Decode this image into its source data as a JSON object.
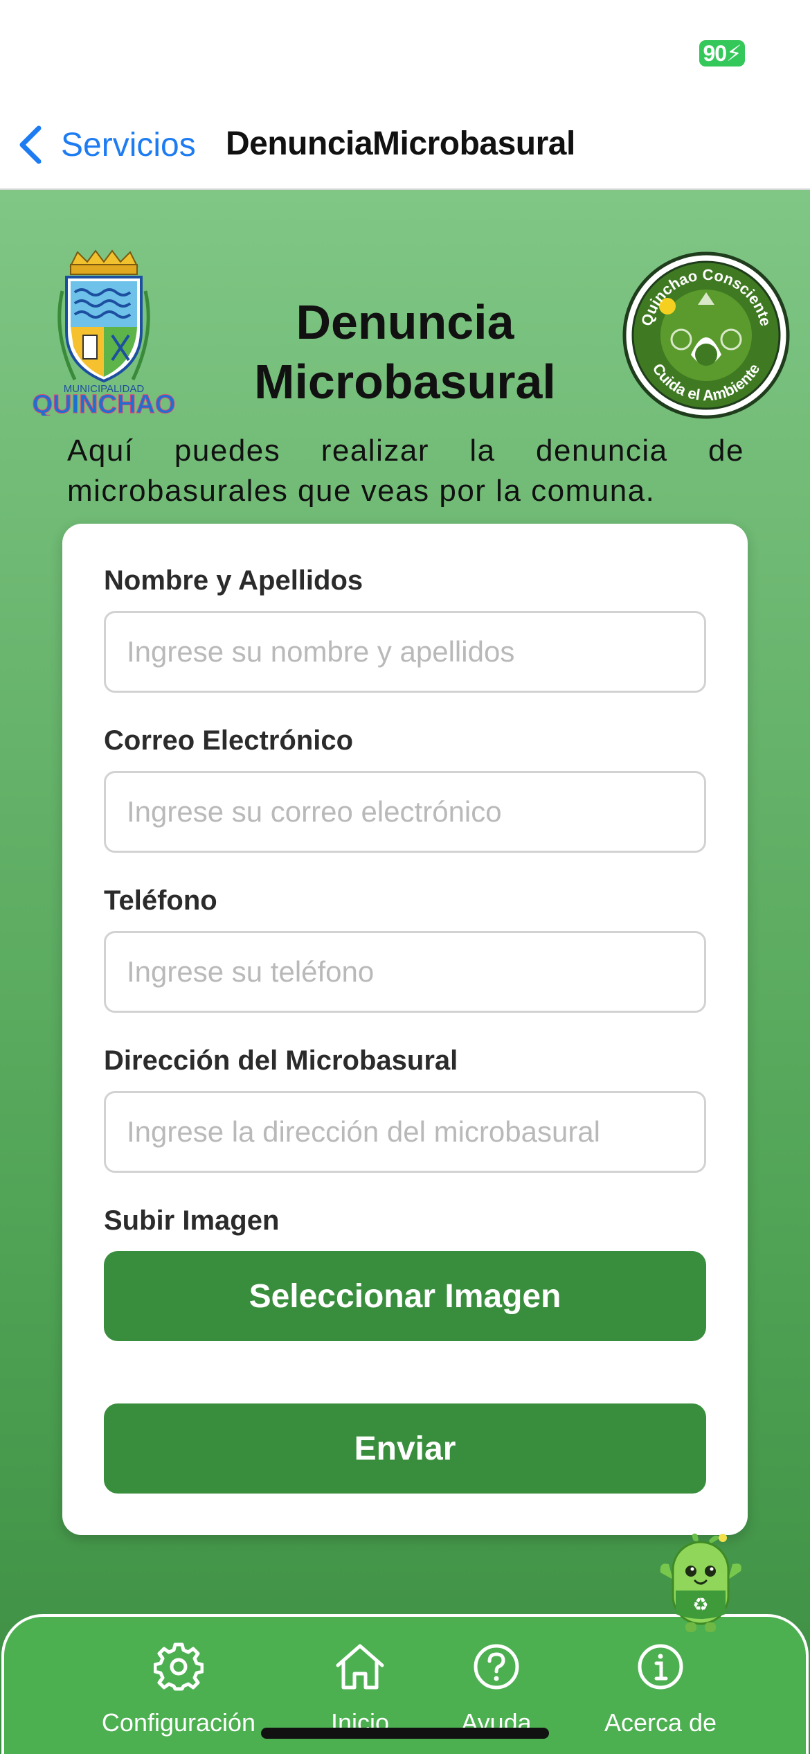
{
  "status_bar": {
    "battery": "90"
  },
  "nav": {
    "back_label": "Servicios",
    "title": "DenunciaMicrobasural"
  },
  "header": {
    "title": "Denuncia Microbasural",
    "logo_left_text_top": "MUNICIPALIDAD",
    "logo_left_text_bottom": "QUINCHAO",
    "logo_right_text_top": "Quinchao Consciente",
    "logo_right_text_bottom": "Cuida el Ambiente"
  },
  "intro": "Aquí puedes realizar la denuncia de microbasurales que veas por la comuna.",
  "form": {
    "name": {
      "label": "Nombre y Apellidos",
      "placeholder": "Ingrese su nombre y apellidos",
      "value": ""
    },
    "email": {
      "label": "Correo Electrónico",
      "placeholder": "Ingrese su correo electrónico",
      "value": ""
    },
    "phone": {
      "label": "Teléfono",
      "placeholder": "Ingrese su teléfono",
      "value": ""
    },
    "address": {
      "label": "Dirección del Microbasural",
      "placeholder": "Ingrese la dirección del microbasural",
      "value": ""
    },
    "image": {
      "label": "Subir Imagen",
      "button": "Seleccionar Imagen"
    },
    "submit": "Enviar"
  },
  "tabs": [
    {
      "label": "Configuración",
      "icon": "gear-icon"
    },
    {
      "label": "Inicio",
      "icon": "home-icon"
    },
    {
      "label": "Ayuda",
      "icon": "help-icon"
    },
    {
      "label": "Acerca de",
      "icon": "info-icon"
    }
  ],
  "colors": {
    "accent_blue": "#1e7cf2",
    "button_green": "#388e3c",
    "tab_bar_green": "#4caf50",
    "battery_green": "#34c759"
  }
}
